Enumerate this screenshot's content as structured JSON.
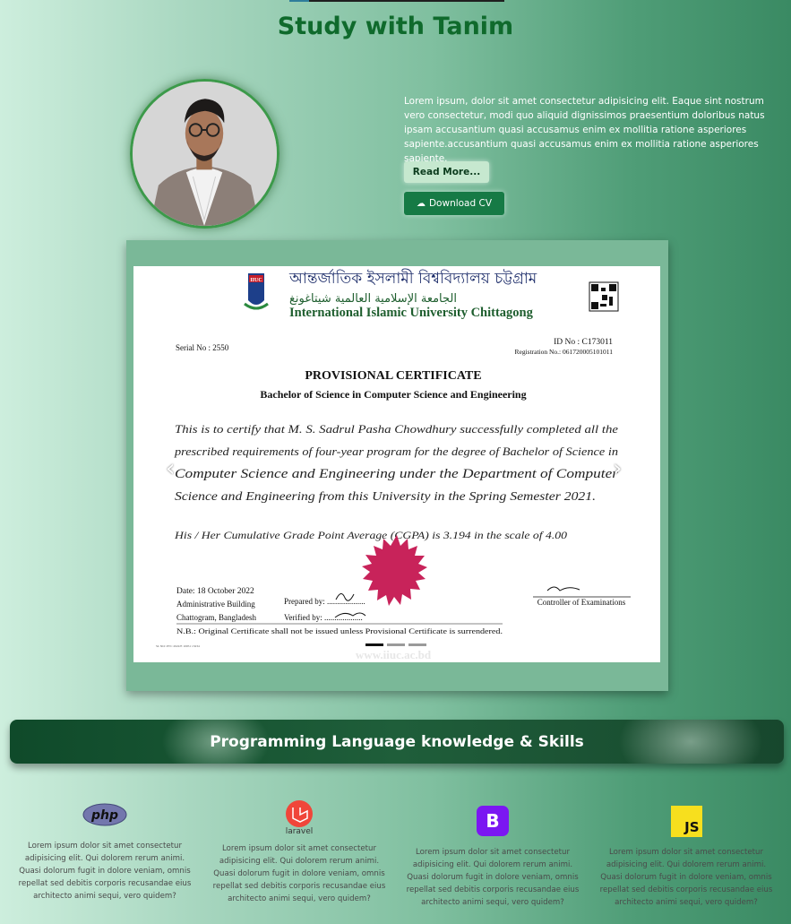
{
  "header": {
    "title": "Study with Tanim"
  },
  "profile": {
    "bio": "Lorem ipsum, dolor sit amet consectetur adipisicing elit. Eaque sint nostrum vero consectetur, modi quo aliquid dignissimos praesentium doloribus natus ipsam accusantium quasi accusamus enim ex mollitia ratione asperiores sapiente.accusantium quasi accusamus enim ex mollitia ratione asperiores sapiente.",
    "read_more_label": "Read More...",
    "download_cv_label": "Download CV"
  },
  "certificate": {
    "university_bn": "আন্তর্জাতিক ইসলামী বিশ্ববিদ্যালয় চট্টগ্রাম",
    "university_ar": "الجامعة الإسلامية العالمية شيتاغونغ",
    "university_en": "International Islamic University Chittagong",
    "logo_text": "IIUC",
    "serial": "Serial No : 2550",
    "id_no": "ID No : C173011",
    "registration": "Registration No.: 061720005101011",
    "heading": "PROVISIONAL CERTIFICATE",
    "degree": "Bachelor of Science in Computer Science and Engineering",
    "body_line1": "This is to certify that M. S. Sadrul Pasha Chowdhury successfully completed all the",
    "body_line2": "prescribed requirements of four-year program for the degree of Bachelor of Science in",
    "body_line3": "Computer Science and Engineering under the Department of Computer",
    "body_line4": "Science and Engineering from this University in the Spring Semester 2021.",
    "cgpa_line": "His / Her Cumulative Grade Point Average (CGPA) is 3.194 in the scale of 4.00",
    "date": "Date: 18 October 2022",
    "address1": "Administrative Building",
    "address2": "Chattogram, Bangladesh",
    "prepared_by": "Prepared by: ...................",
    "verified_by": "Verified by: ...................",
    "controller": "Controller of Examinations",
    "note": "N.B.: Original Certificate shall not be issued unless Provisional Certificate is surrendered.",
    "watermark": "www.iiuc.ac.bd",
    "small_code": "SL NO: PVC 2022/E 10051 13234",
    "slide_count": 3,
    "active_slide": 1
  },
  "skills": {
    "heading": "Programming Language knowledge & Skills",
    "items": [
      {
        "icon": "php-icon",
        "icon_text": "php",
        "description": "Lorem ipsum dolor sit amet consectetur adipisicing elit. Qui dolorem rerum animi. Quasi dolorum fugit in dolore veniam, omnis repellat sed debitis corporis recusandae eius architecto animi sequi, vero quidem?"
      },
      {
        "icon": "laravel-icon",
        "icon_text": "laravel",
        "description": "Lorem ipsum dolor sit amet consectetur adipisicing elit. Qui dolorem rerum animi. Quasi dolorum fugit in dolore veniam, omnis repellat sed debitis corporis recusandae eius architecto animi sequi, vero quidem?"
      },
      {
        "icon": "bootstrap-icon",
        "icon_text": "B",
        "description": "Lorem ipsum dolor sit amet consectetur adipisicing elit. Qui dolorem rerum animi. Quasi dolorum fugit in dolore veniam, omnis repellat sed debitis corporis recusandae eius architecto animi sequi, vero quidem?"
      },
      {
        "icon": "javascript-icon",
        "icon_text": "JS",
        "description": "Lorem ipsum dolor sit amet consectetur adipisicing elit. Qui dolorem rerum animi. Quasi dolorum fugit in dolore veniam, omnis repellat sed debitis corporis recusandae eius architecto animi sequi, vero quidem?"
      }
    ]
  },
  "colors": {
    "title_green": "#0f6a2c",
    "button_green": "#167a45",
    "button_light": "#c6e8cf",
    "seal_red": "#c8235a"
  }
}
